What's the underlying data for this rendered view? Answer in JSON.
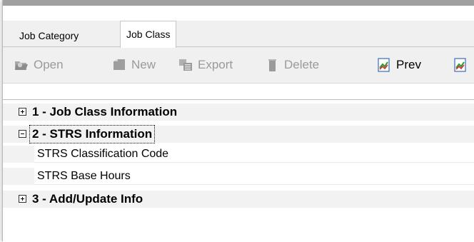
{
  "tabs": [
    {
      "label": "Job Category",
      "active": false
    },
    {
      "label": "Job Class",
      "active": true
    }
  ],
  "toolbar": {
    "open_label": "Open",
    "new_label": "New",
    "export_label": "Export",
    "delete_label": "Delete",
    "prev_label": "Prev"
  },
  "property_grid": {
    "categories": [
      {
        "label": "1 - Job Class Information",
        "expanded": false
      },
      {
        "label": "2 - STRS Information",
        "expanded": true,
        "properties": [
          "STRS Classification Code",
          "STRS Base Hours"
        ]
      },
      {
        "label": "3 - Add/Update Info",
        "expanded": false
      }
    ]
  },
  "colors": {
    "disabled_text": "#9a9a9a",
    "category_bg": "#f2f2f2",
    "toolbar_bg": "#f0f0f0"
  }
}
